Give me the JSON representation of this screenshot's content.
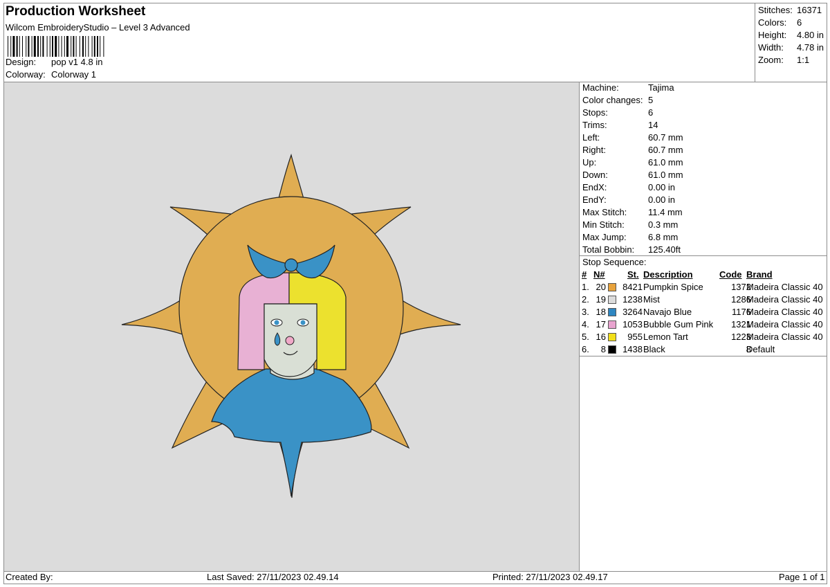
{
  "header": {
    "title": "Production Worksheet",
    "software": "Wilcom EmbroideryStudio – Level 3 Advanced",
    "design_label": "Design:",
    "design_value": "pop v1 4.8 in",
    "colorway_label": "Colorway:",
    "colorway_value": "Colorway 1"
  },
  "summary": [
    {
      "label": "Stitches:",
      "value": "16371"
    },
    {
      "label": "Colors:",
      "value": "6"
    },
    {
      "label": "Height:",
      "value": "4.80 in"
    },
    {
      "label": "Width:",
      "value": "4.78 in"
    },
    {
      "label": "Zoom:",
      "value": "1:1"
    }
  ],
  "machine_info": [
    {
      "label": "Machine:",
      "value": "Tajima"
    },
    {
      "label": "Color changes:",
      "value": "5"
    },
    {
      "label": "Stops:",
      "value": "6"
    },
    {
      "label": "Trims:",
      "value": "14"
    },
    {
      "label": "Left:",
      "value": "60.7 mm"
    },
    {
      "label": "Right:",
      "value": "60.7 mm"
    },
    {
      "label": "Up:",
      "value": "61.0 mm"
    },
    {
      "label": "Down:",
      "value": "61.0 mm"
    },
    {
      "label": "EndX:",
      "value": "0.00 in"
    },
    {
      "label": "EndY:",
      "value": "0.00 in"
    },
    {
      "label": "Max Stitch:",
      "value": "11.4 mm"
    },
    {
      "label": "Min Stitch:",
      "value": "0.3 mm"
    },
    {
      "label": "Max Jump:",
      "value": "6.8 mm"
    },
    {
      "label": "Total Bobbin:",
      "value": "125.40ft"
    }
  ],
  "stop_sequence": {
    "title": "Stop Sequence:",
    "headers": {
      "num": "#",
      "n": "N#",
      "st": "St.",
      "desc": "Description",
      "code": "Code",
      "brand": "Brand"
    },
    "rows": [
      {
        "num": "1.",
        "n": "20",
        "color": "#e8a33c",
        "st": "8421",
        "desc": "Pumpkin Spice",
        "code": "1372",
        "brand": "Madeira Classic 40"
      },
      {
        "num": "2.",
        "n": "19",
        "color": "#dcdcdc",
        "st": "1238",
        "desc": "Mist",
        "code": "1286",
        "brand": "Madeira Classic 40"
      },
      {
        "num": "3.",
        "n": "18",
        "color": "#2e86c1",
        "st": "3264",
        "desc": "Navajo Blue",
        "code": "1176",
        "brand": "Madeira Classic 40"
      },
      {
        "num": "4.",
        "n": "17",
        "color": "#e8a3cf",
        "st": "1053",
        "desc": "Bubble Gum Pink",
        "code": "1321",
        "brand": "Madeira Classic 40"
      },
      {
        "num": "5.",
        "n": "16",
        "color": "#f2df1a",
        "st": "955",
        "desc": "Lemon Tart",
        "code": "1223",
        "brand": "Madeira Classic 40"
      },
      {
        "num": "6.",
        "n": "8",
        "color": "#000000",
        "st": "1438",
        "desc": "Black",
        "code": "8",
        "brand": "Default"
      }
    ]
  },
  "footer": {
    "created_by": "Created By:",
    "last_saved": "Last Saved: 27/11/2023 02.49.14",
    "printed": "Printed: 27/11/2023 02.49.17",
    "page": "Page 1 of 1"
  },
  "design_colors": {
    "sun": "#e0ad52",
    "blue": "#3a92c6",
    "pink": "#e8b1d4",
    "yellow": "#ece12e",
    "face": "#d9dfd5",
    "outline": "#222222",
    "canvas": "#dcdcdc"
  }
}
